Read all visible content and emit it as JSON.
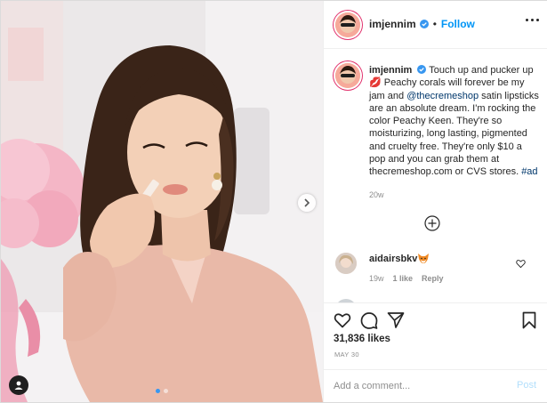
{
  "post": {
    "author": "imjennim",
    "follow_label": "Follow",
    "separator": "•",
    "caption": {
      "username": "imjennim",
      "part1": " Touch up and pucker up 💋 Peachy corals will forever be my jam and ",
      "mention": "@thecremeshop",
      "part2": " satin lipsticks are an absolute dream. I'm rocking the color Peachy Keen. They're so moisturizing, long lasting, pigmented and cruelty free. They're only $10 a pop and you can grab them at thecremeshop.com or CVS stores. ",
      "hashtag": "#ad",
      "time_ago": "20w"
    },
    "comments": [
      {
        "username": "aidairsbkv",
        "emoji": "fox-emoji",
        "time_ago": "19w",
        "likes": "1 like",
        "reply_label": "Reply"
      }
    ],
    "likes_count": "31,836 likes",
    "date": "MAY 30",
    "add_comment": {
      "placeholder": "Add a comment...",
      "post_label": "Post"
    },
    "carousel": {
      "current": 1,
      "total": 2
    }
  },
  "icons": {
    "header": [
      "verified-badge-icon",
      "more-options-icon"
    ],
    "actions": [
      "heart-icon",
      "comment-icon",
      "share-icon",
      "bookmark-icon"
    ],
    "photo": [
      "next-arrow-icon",
      "user-tag-icon"
    ],
    "thread": [
      "load-more-comments-icon"
    ]
  },
  "colors": {
    "link_blue": "#0095f6",
    "mention_blue": "#00376b",
    "secondary_text": "#8e8e8e",
    "post_disabled": "#b2dffc",
    "border": "#efefef"
  }
}
